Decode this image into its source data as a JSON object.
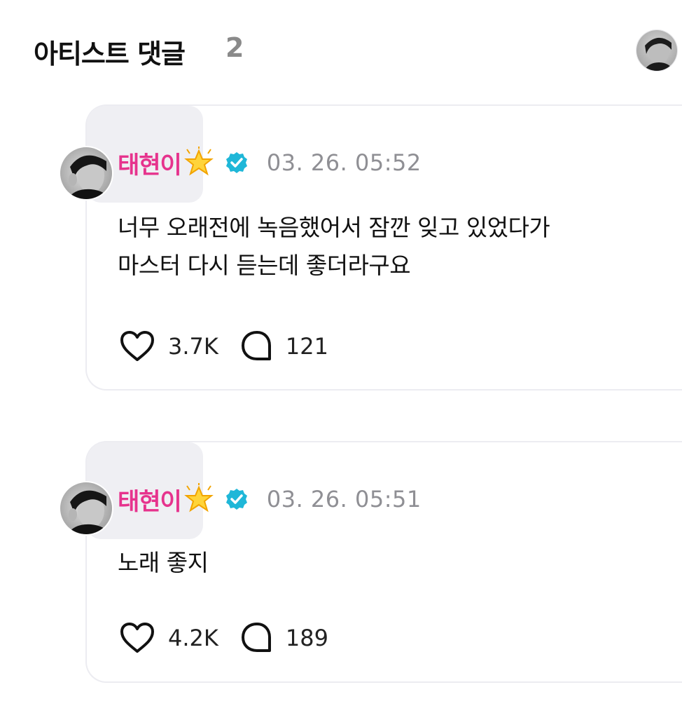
{
  "header": {
    "title": "아티스트 댓글",
    "count": "2"
  },
  "comments": [
    {
      "author": "태현이",
      "badges": [
        "sparkle-star-icon",
        "verified-check-icon"
      ],
      "timestamp": "03. 26. 05:52",
      "text": "너무 오래전에 녹음했어서 잠깐 잊고 있었다가\n마스터 다시 듣는데 좋더라구요",
      "likes": "3.7K",
      "replies": "121"
    },
    {
      "author": "태현이",
      "badges": [
        "sparkle-star-icon",
        "verified-check-icon"
      ],
      "timestamp": "03. 26. 05:51",
      "text": "노래 좋지",
      "likes": "4.2K",
      "replies": "189"
    }
  ],
  "colors": {
    "author": "#e6338d",
    "verified": "#1fb7d8",
    "timestamp": "#8f8f94",
    "count_muted": "#8a8a8a",
    "card_border": "#ececf1",
    "highlight": "#efeff3"
  }
}
